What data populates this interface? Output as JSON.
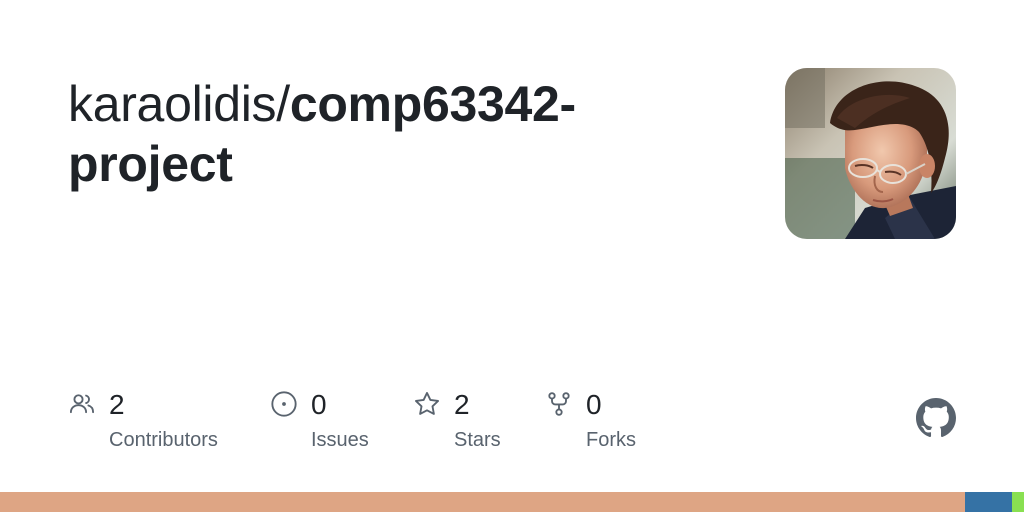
{
  "repo": {
    "owner": "karaolidis/",
    "name": "comp63342-project"
  },
  "avatar": {
    "alt": "owner avatar photo"
  },
  "stats": [
    {
      "icon": "people-icon",
      "count": "2",
      "label": "Contributors"
    },
    {
      "icon": "issue-icon",
      "count": "0",
      "label": "Issues"
    },
    {
      "icon": "star-icon",
      "count": "2",
      "label": "Stars"
    },
    {
      "icon": "fork-icon",
      "count": "0",
      "label": "Forks"
    }
  ],
  "brand": {
    "logo": "github-icon",
    "logo_color": "#59636e"
  },
  "language_bar": [
    {
      "color": "#dea584",
      "fraction": 0.942
    },
    {
      "color": "#3572a5",
      "fraction": 0.046
    },
    {
      "color": "#89e051",
      "fraction": 0.012
    }
  ]
}
